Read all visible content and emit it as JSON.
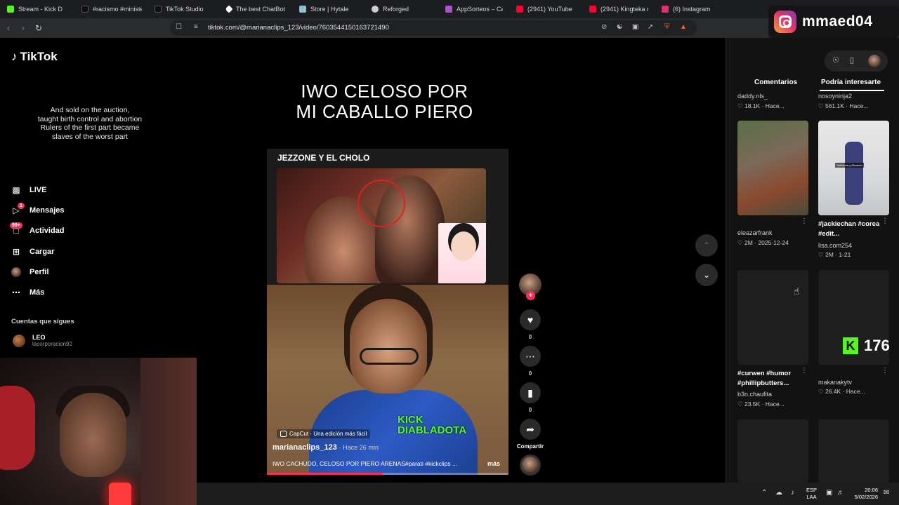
{
  "browser": {
    "tabs": [
      {
        "label": "Stream - Kick D",
        "color": "#53fc18"
      },
      {
        "label": "#racismo #minister",
        "color": "#ffffff"
      },
      {
        "label": "TikTok Studio",
        "color": "#ffffff"
      },
      {
        "label": "The best ChatBot ar",
        "color": "#ffffff"
      },
      {
        "label": "Store | Hytale",
        "color": "#8fc0d0"
      },
      {
        "label": "Reforged",
        "color": "#cfcfcf"
      },
      {
        "label": "AppSorteos – Cara",
        "color": "#b04fd0"
      },
      {
        "label": "(2941) YouTube",
        "color": "#ff0033"
      },
      {
        "label": "(2941) Kingteka rea",
        "color": "#ff0033"
      },
      {
        "label": "(6) Instagram",
        "color": "#e1306c"
      }
    ],
    "url": "tiktok.com/@marianaclips_123/video/7603544150163721490"
  },
  "instagram_overlay": {
    "handle": "mmaed04"
  },
  "tiktok": {
    "logo": "TikTok",
    "lyrics": [
      "And sold on the auction,",
      "taught birth control and abortion",
      "Rulers of the first part became",
      "slaves of the worst part"
    ],
    "nav": [
      {
        "label": "LIVE",
        "icon": "live-icon"
      },
      {
        "label": "Mensajes",
        "icon": "messages-icon",
        "badge": "1"
      },
      {
        "label": "Actividad",
        "icon": "activity-icon",
        "badge": "99+"
      },
      {
        "label": "Cargar",
        "icon": "upload-icon"
      },
      {
        "label": "Perfil",
        "icon": "profile-icon"
      },
      {
        "label": "Más",
        "icon": "more-icon"
      }
    ],
    "following_header": "Cuentas que sigues",
    "following": [
      {
        "name": "LEO",
        "handle": "lacorporacion92"
      }
    ]
  },
  "video": {
    "title_line1": "IWO CELOSO POR",
    "title_line2": "MI CABALLO PIERO",
    "clip_label": "JEZZONE Y EL CHOLO",
    "kick_line1": "KICK",
    "kick_line2": "DIABLADOTA",
    "capcut": "CapCut · Una edición más fácil",
    "author": "marianaclips_123",
    "time": "· Hace 26 min",
    "description": "IWO CACHUDO, CELOSO POR PIERO ARENAS#parati #kickclips ...",
    "more": "más",
    "progress": 0.48
  },
  "actions": {
    "like_count": "0",
    "comment_count": "0",
    "save_count": "0",
    "share_label": "Compartir"
  },
  "right_panel": {
    "tab_comments": "Comentarios",
    "tab_interest": "Podría interesarte",
    "cards": [
      {
        "author": "daddy.nls_",
        "stats": "♡ 18.1K · Hace..."
      },
      {
        "author": "nosoyninja2",
        "stats": "♡ 561.1K · Hace..."
      },
      {
        "author": "eleazarfrank",
        "title": "",
        "stats": "♡ 2M · 2025-12-24"
      },
      {
        "author": "lisa.com254",
        "title": "#jackiechan #corea #edit...",
        "stats": "♡ 2M · 1-21"
      },
      {
        "author": "b3n.chaufita",
        "title": "#curwen #humor #phillipbutters...",
        "stats": "♡ 23.5K · Hace..."
      },
      {
        "author": "makanakytv",
        "title": "",
        "stats": "♡ 26.4K · Hace..."
      }
    ],
    "thumb_caption": "Sabiduría y Alimento"
  },
  "kick_overlay": {
    "count": "176"
  },
  "taskbar": {
    "lang_line1": "ESP",
    "lang_line2": "LAA",
    "time": "20:06",
    "date": "5/02/2026"
  }
}
